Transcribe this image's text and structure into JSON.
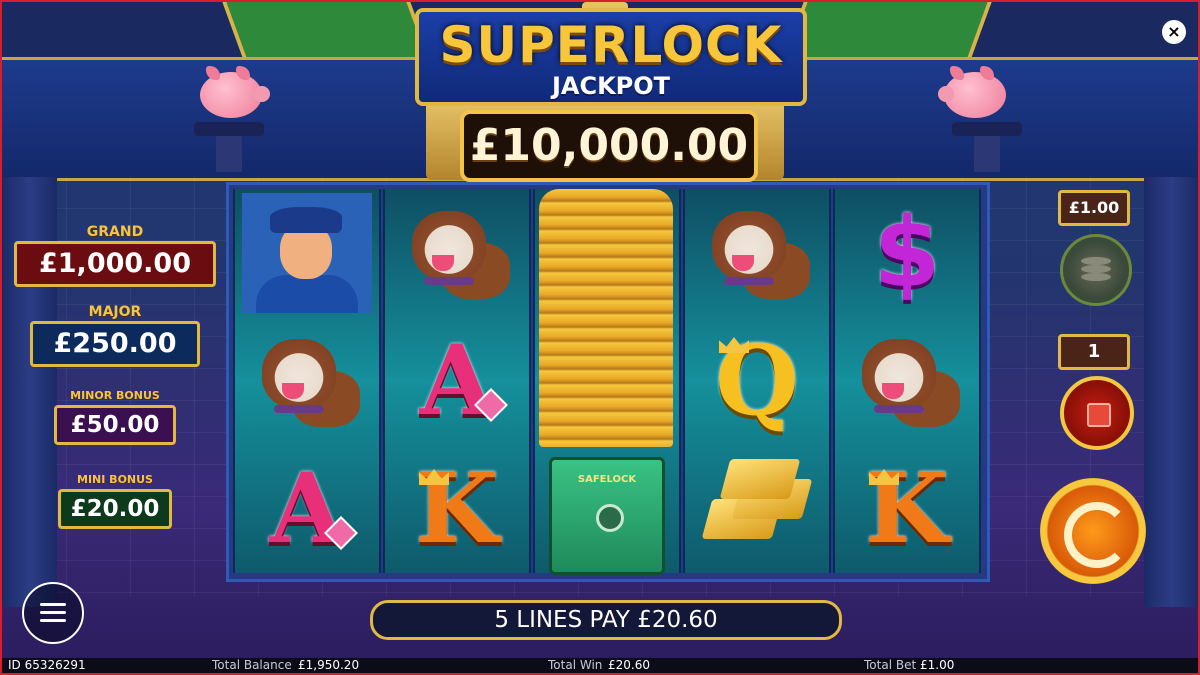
{
  "header": {
    "logo_title": "SUPERLOCK",
    "logo_subtitle": "JACKPOT",
    "jackpot_value": "£10,000.00"
  },
  "prizes": [
    {
      "label": "GRAND",
      "value": "£1,000.00"
    },
    {
      "label": "MAJOR",
      "value": "£250.00"
    },
    {
      "label": "MINOR BONUS",
      "value": "£50.00"
    },
    {
      "label": "MINI BONUS",
      "value": "£20.00"
    }
  ],
  "reels": [
    [
      "policeman",
      "bulldog",
      "A"
    ],
    [
      "bulldog",
      "A",
      "K"
    ],
    [
      "coin-stack",
      "coin-stack",
      "safe"
    ],
    [
      "bulldog",
      "Q",
      "gold-bars"
    ],
    [
      "$",
      "bulldog",
      "K"
    ]
  ],
  "symbols": {
    "A": "A",
    "K": "K",
    "Q": "Q",
    "dollar": "$",
    "safe_text": "SAFELOCK"
  },
  "controls": {
    "bet_value": "£1.00",
    "autoplay_count": "1",
    "close_label": "×"
  },
  "win_message": "5 LINES PAY £20.60",
  "footer": {
    "id": "ID 65326291",
    "balance_label": "Total Balance",
    "balance_value": "£1,950.20",
    "win_label": "Total Win",
    "win_value": "£20.60",
    "bet_label": "Total Bet",
    "bet_value": "£1.00"
  },
  "colors": {
    "border": "#d81e2a",
    "gold": "#e2b940",
    "reel_bg": "#15909c"
  }
}
